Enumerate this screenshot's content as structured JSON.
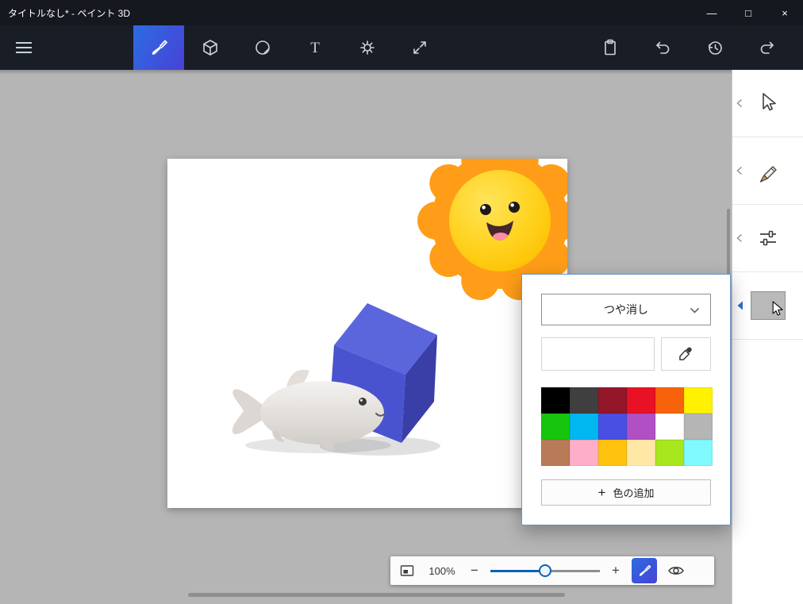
{
  "window": {
    "title": "タイトルなし* - ペイント 3D",
    "minimize_glyph": "—",
    "maximize_glyph": "□",
    "close_glyph": "×"
  },
  "toolbar": {
    "tools": [
      "menu",
      "brush",
      "3d-shapes",
      "stickers",
      "text",
      "effects",
      "canvas"
    ],
    "selected_tool": "brush",
    "text_tool_glyph": "T",
    "actions": [
      "paste",
      "undo",
      "history",
      "redo"
    ]
  },
  "sidebar": {
    "items": [
      "select-tool",
      "pencil-tool",
      "adjust-tool",
      "color-swatch"
    ],
    "swatch_color": "#b9b9b9"
  },
  "flyout": {
    "finish_dropdown_value": "つや消し",
    "add_color_plus": "+",
    "add_color_label": "色の追加",
    "palette": [
      [
        "#000000",
        "#3f3f3f",
        "#931629",
        "#e81224",
        "#f7630c",
        "#fff100"
      ],
      [
        "#16c60c",
        "#00b7f0",
        "#4a4fe4",
        "#b14fc5",
        "#ffffff",
        "#b5b5b5"
      ],
      [
        "#b97a57",
        "#ffaec9",
        "#ffc20e",
        "#ffe8a6",
        "#a8e61d",
        "#80f9ff"
      ]
    ]
  },
  "zoombar": {
    "zoom_value": "100%",
    "zoom_out_glyph": "−",
    "zoom_in_glyph": "+",
    "slider_percent": 50
  },
  "colors": {
    "accent": "#0f62b4",
    "selected_tool_gradient": [
      "#2d6ce2",
      "#4742d6"
    ],
    "toolbar_bg": "#191d26",
    "canvas_bg": "#b5b5b5"
  },
  "icons": [
    "menu-icon",
    "brush-icon",
    "cube-icon",
    "sticker-icon",
    "text-icon",
    "effects-icon",
    "expand-icon",
    "paste-icon",
    "undo-icon",
    "history-icon",
    "redo-icon",
    "select-arrow-icon",
    "pencil-icon",
    "sliders-icon",
    "eyedropper-icon",
    "chevron-down-icon",
    "fit-screen-icon",
    "eye-icon",
    "cursor-icon"
  ]
}
